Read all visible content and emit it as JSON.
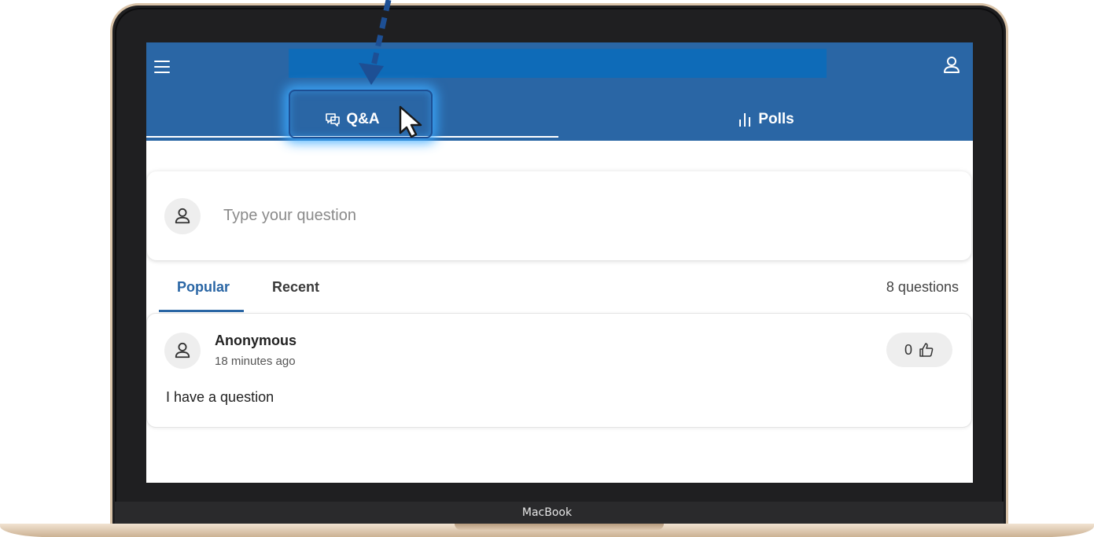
{
  "device": {
    "brand_label": "MacBook"
  },
  "header": {
    "menu_icon": "hamburger-menu-icon",
    "profile_icon": "user-profile-icon",
    "colors": {
      "header_bg": "#2a66a5",
      "redacted_bar": "#0e6bb8"
    }
  },
  "tabs": [
    {
      "label": "Q&A",
      "icon": "chat-bubbles-icon",
      "active": true
    },
    {
      "label": "Polls",
      "icon": "bar-chart-icon",
      "active": false
    }
  ],
  "ask": {
    "placeholder": "Type your question"
  },
  "sort": {
    "options": [
      {
        "label": "Popular",
        "active": true
      },
      {
        "label": "Recent",
        "active": false
      }
    ],
    "count_text": "8 questions"
  },
  "questions": [
    {
      "author": "Anonymous",
      "time": "18 minutes ago",
      "text": "I have a question",
      "likes": "0",
      "like_icon": "thumbs-up-icon"
    }
  ],
  "overlay": {
    "highlight_color": "#3caaff",
    "arrow_color": "#1d4f94",
    "cursor_icon": "mouse-pointer-icon"
  }
}
